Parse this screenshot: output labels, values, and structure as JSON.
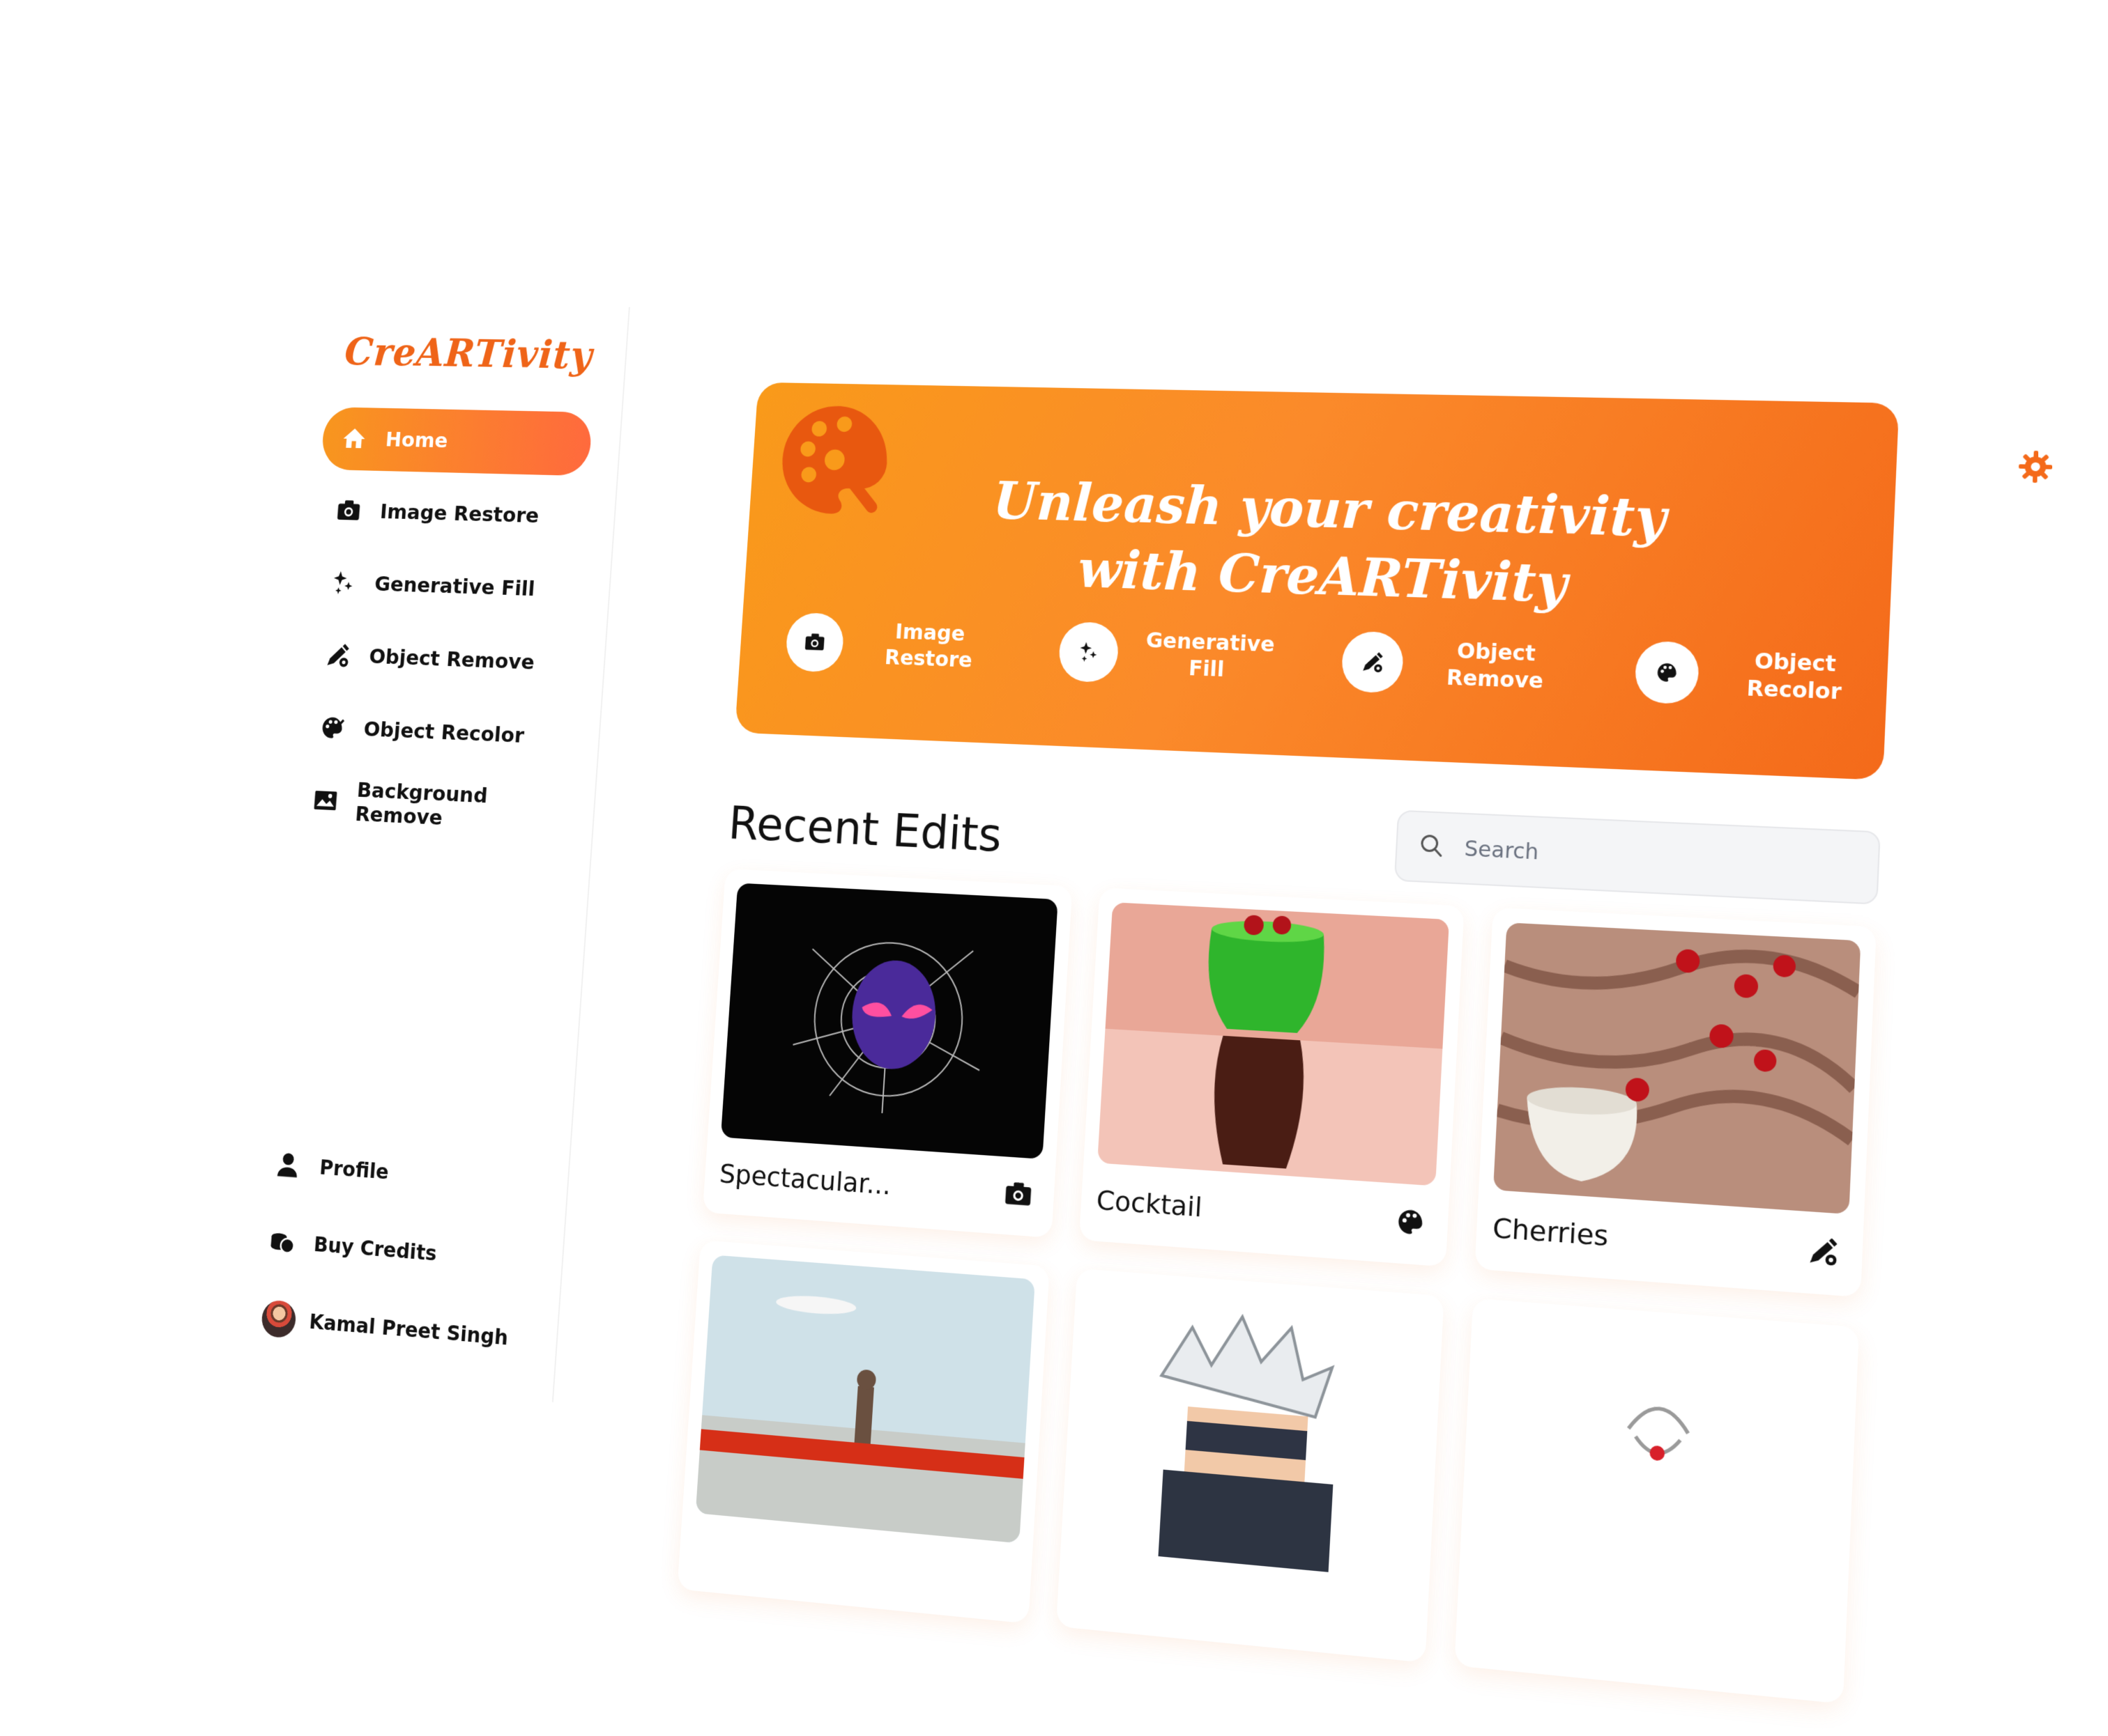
{
  "app": {
    "logo": "CreARTivity"
  },
  "sidebar": {
    "items": [
      {
        "label": "Home",
        "icon": "home-icon",
        "active": true
      },
      {
        "label": "Image Restore",
        "icon": "camera-icon"
      },
      {
        "label": "Generative Fill",
        "icon": "sparkles-icon"
      },
      {
        "label": "Object Remove",
        "icon": "pen-gear-icon"
      },
      {
        "label": "Object Recolor",
        "icon": "palette-gear-icon"
      },
      {
        "label": "Background Remove",
        "icon": "image-icon"
      }
    ],
    "bottom": [
      {
        "label": "Profile",
        "icon": "user-icon"
      },
      {
        "label": "Buy Credits",
        "icon": "coins-icon"
      },
      {
        "label": "Kamal Preet Singh",
        "icon": "avatar"
      }
    ]
  },
  "banner": {
    "title_line1": "Unleash your creativity",
    "title_line2": "with CreARTivity",
    "actions": [
      {
        "label_line1": "Image",
        "label_line2": "Restore",
        "icon": "camera-icon"
      },
      {
        "label_line1": "Generative",
        "label_line2": "Fill",
        "icon": "sparkles-icon"
      },
      {
        "label_line1": "Object",
        "label_line2": "Remove",
        "icon": "pen-gear-icon"
      },
      {
        "label_line1": "Object",
        "label_line2": "Recolor",
        "icon": "palette-gear-icon"
      }
    ]
  },
  "recent": {
    "title": "Recent Edits",
    "search_placeholder": "Search",
    "cards": [
      {
        "title": "Spectacular...",
        "icon": "camera-icon"
      },
      {
        "title": "Cocktail",
        "icon": "palette-gear-icon"
      },
      {
        "title": "Cherries",
        "icon": "pen-gear-icon"
      },
      {
        "title": "",
        "icon": ""
      },
      {
        "title": "",
        "icon": ""
      },
      {
        "title": "",
        "icon": ""
      }
    ]
  },
  "colors": {
    "accent": "#f46a1a",
    "accent_light": "#f99a1a",
    "logo": "#ef6418"
  }
}
